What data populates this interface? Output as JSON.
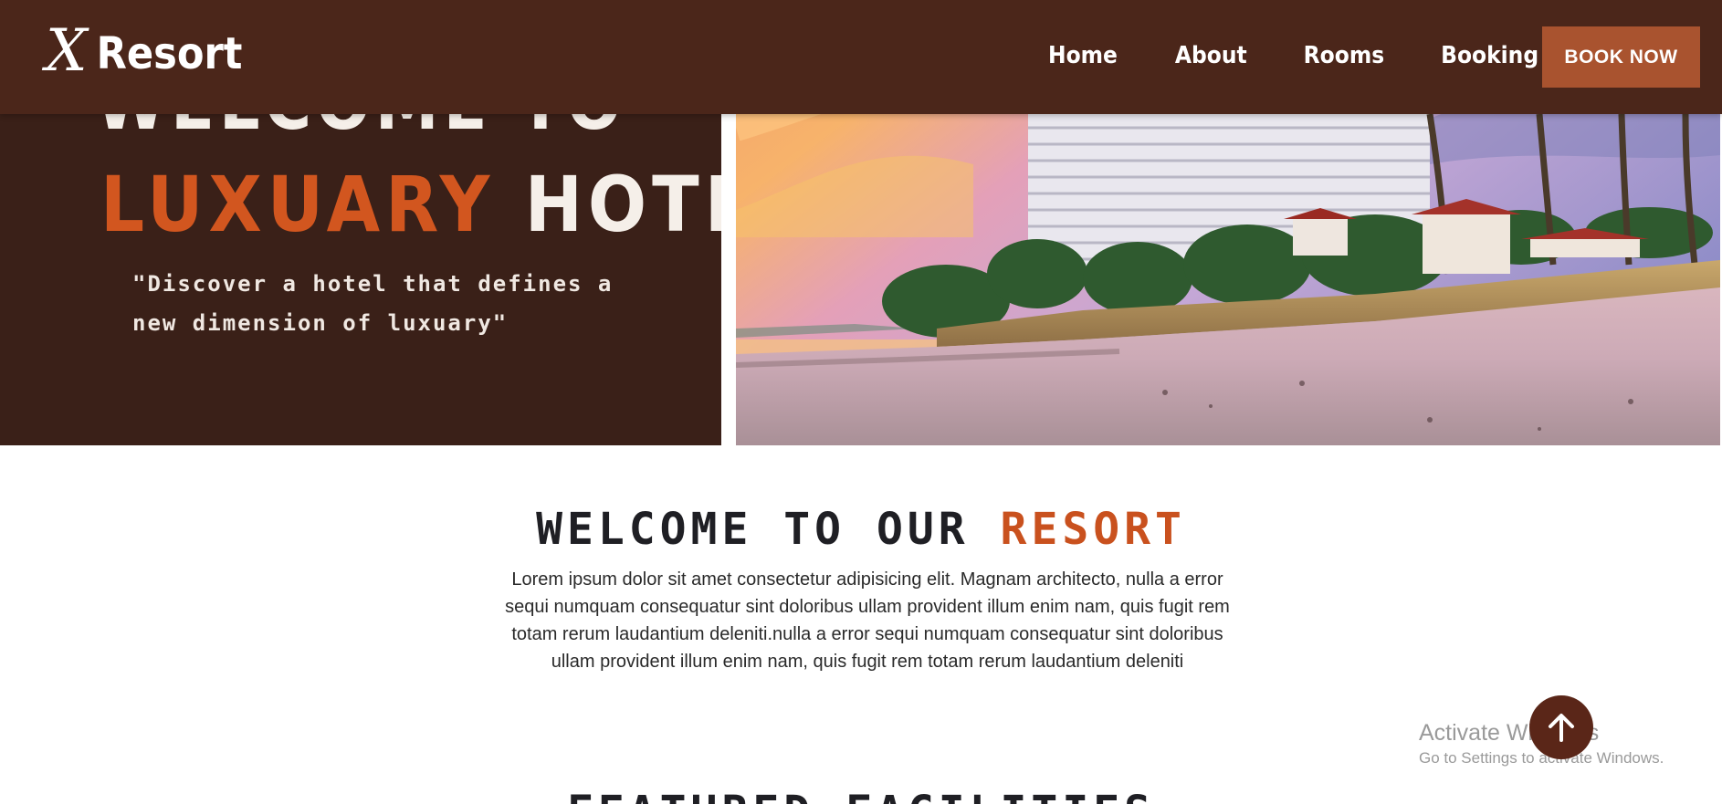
{
  "navbar": {
    "brand_mark": "X",
    "brand_name": "Resort",
    "links": {
      "home": "Home",
      "about": "About",
      "rooms": "Rooms",
      "booking": "Booking"
    },
    "cta_label": "BOOK NOW"
  },
  "hero": {
    "line1": "WELCOME TO",
    "line2_accent": "LUXUARY",
    "line2_rest": "HOTEL",
    "quote": "\"Discover a hotel that defines a new dimension of luxuary\"",
    "image_icon": "beach-resort-photo"
  },
  "welcome": {
    "title_main": "WELCOME TO OUR",
    "title_accent": "RESORT",
    "body": "Lorem ipsum dolor sit amet consectetur adipisicing elit. Magnam architecto, nulla a error sequi numquam consequatur sint doloribus ullam provident illum enim nam, quis fugit rem totam rerum laudantium deleniti.nulla a error sequi numquam consequatur sint doloribus ullam provident illum enim nam, quis fugit rem totam rerum laudantium deleniti"
  },
  "featured": {
    "title": "FEATURED FACILITIES"
  },
  "scroll_top": {
    "icon": "arrow-up-icon"
  },
  "watermark": {
    "title": "Activate Windows",
    "subtitle": "Go to Settings to activate Windows."
  },
  "colors": {
    "navbar_bg": "#4b261a",
    "hero_bg": "#3a2018",
    "accent": "#c9511e",
    "cta_bg": "#a9532f",
    "scroll_btn": "#5a2618"
  }
}
